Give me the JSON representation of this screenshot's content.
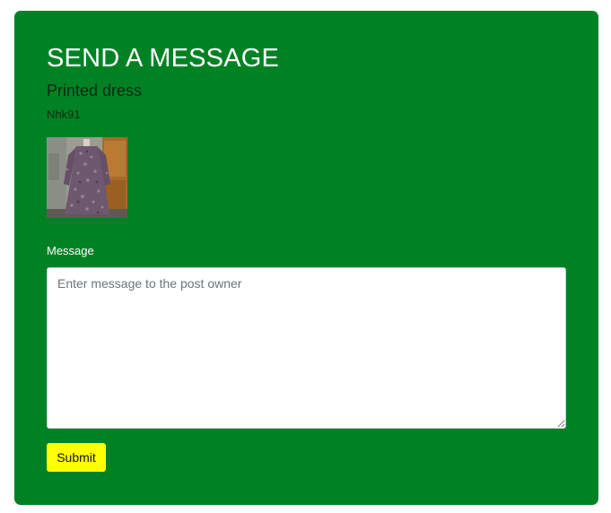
{
  "header": {
    "title": "SEND A MESSAGE"
  },
  "post": {
    "title": "Printed dress",
    "owner": "Nhk91"
  },
  "form": {
    "message_label": "Message",
    "message_placeholder": "Enter message to the post owner",
    "message_value": "",
    "submit_label": "Submit"
  },
  "colors": {
    "card_background": "#008224",
    "submit_button": "#ffff00",
    "title_text": "#ffffff"
  }
}
